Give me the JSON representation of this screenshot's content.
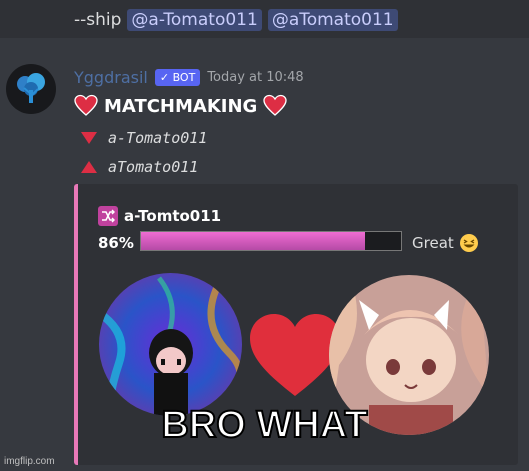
{
  "command": {
    "prefix": "--ship",
    "mentions": [
      "@a-Tomato011",
      "@aTomato011"
    ]
  },
  "message": {
    "author": "Yggdrasil",
    "bot_tag": "BOT",
    "timestamp": "Today at 10:48",
    "title": "MATCHMAKING",
    "users": [
      "a-Tomato011",
      "aTomato011"
    ]
  },
  "embed": {
    "ship_name": "a-Tomto011",
    "percent_label": "86%",
    "percent_value": 0.86,
    "rating": "Great",
    "accent_color": "#e878b8"
  },
  "meme": {
    "caption": "BRO WHAT"
  },
  "watermark": "imgflip.com"
}
